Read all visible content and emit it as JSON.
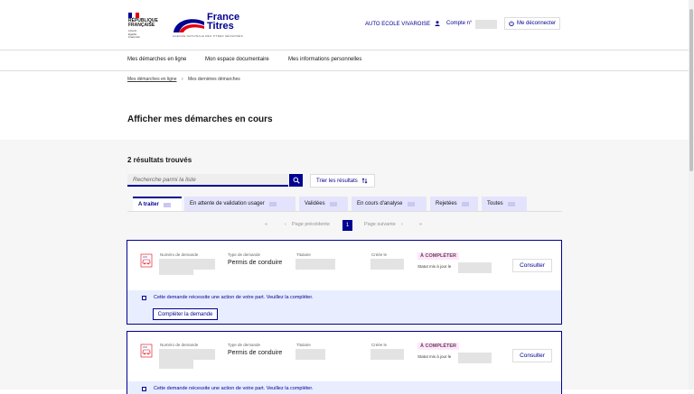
{
  "header": {
    "republic": [
      "RÉPUBLIQUE",
      "FRANÇAISE"
    ],
    "motto": [
      "Liberté",
      "Égalité",
      "Fraternité"
    ],
    "brand_line1": "France",
    "brand_line2": "Titres",
    "brand_sub": "AGENCE NATIONALE DES TITRES SÉCURISÉS",
    "user_label": "AUTO ECOLE VIVAROISE",
    "account_label": "Compte n°",
    "logout_label": "Me déconnecter",
    "colors": {
      "primary": "#000091",
      "red": "#e1000f"
    }
  },
  "nav": {
    "items": [
      "Mes démarches en ligne",
      "Mon espace documentaire",
      "Mes informations personnelles"
    ]
  },
  "breadcrumb": {
    "home": "Mes démarches en ligne",
    "separator": "›",
    "current": "Mes dernières démarches"
  },
  "page": {
    "title": "Afficher mes démarches en cours",
    "results": "2 résultats trouvés"
  },
  "search": {
    "placeholder": "Recherche parmi la liste",
    "sort_label": "Trier les résultats",
    "sort_icon": "sort-arrows-icon"
  },
  "tabs": [
    {
      "label": "A traiter",
      "active": true
    },
    {
      "label": "En attente de validation usager",
      "active": false
    },
    {
      "label": "Validées",
      "active": false
    },
    {
      "label": "En cours d'analyse",
      "active": false
    },
    {
      "label": "Rejetées",
      "active": false
    },
    {
      "label": "Toutes",
      "active": false
    }
  ],
  "pagination": {
    "first": "«",
    "prev_arrow": "‹",
    "prev": "Page précédente",
    "current": "1",
    "next": "Page suivante",
    "next_arrow": "›",
    "last": "»"
  },
  "cards": [
    {
      "label_number": "Numéro de demande",
      "label_type": "Type de demande",
      "type_value": "Permis de conduire",
      "label_holder": "Titulaire",
      "label_created": "Créée le",
      "badge": "À COMPLÉTER",
      "status": "Statut mis à jour le",
      "consult": "Consulter",
      "action_text": "Cette demande nécessite une action de votre part. Veuillez la compléter.",
      "action_button": "Compléter la demande"
    },
    {
      "label_number": "Numéro de demande",
      "label_type": "Type de demande",
      "type_value": "Permis de conduire",
      "label_holder": "Titulaire",
      "label_created": "Créée le",
      "badge": "À COMPLÉTER",
      "status": "Statut mis à jour le",
      "consult": "Consulter",
      "action_text": "Cette demande nécessite une action de votre part. Veuillez la compléter."
    }
  ]
}
